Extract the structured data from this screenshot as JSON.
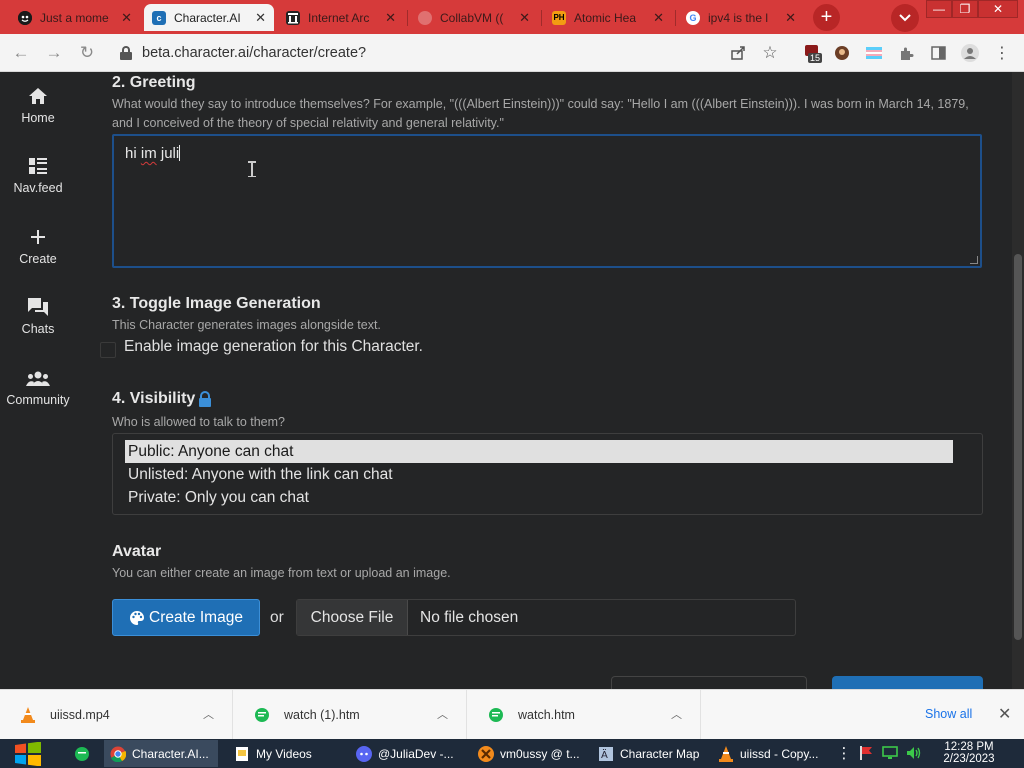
{
  "browser": {
    "tabs": [
      {
        "title": "Just a mome"
      },
      {
        "title": "Character.AI"
      },
      {
        "title": "Internet Arc"
      },
      {
        "title": "CollabVM (("
      },
      {
        "title": "Atomic Hea"
      },
      {
        "title": "ipv4 is the l"
      }
    ],
    "url": "beta.character.ai/character/create?",
    "extension_badge": "15"
  },
  "sidebar": {
    "items": [
      {
        "label": "Home"
      },
      {
        "label": "Nav.feed"
      },
      {
        "label": "Create"
      },
      {
        "label": "Chats"
      },
      {
        "label": "Community"
      }
    ]
  },
  "form": {
    "greeting": {
      "heading": "2. Greeting",
      "hint": "What would they say to introduce themselves? For example, \"(((Albert Einstein)))\" could say: \"Hello I am (((Albert Einstein))). I was born in March 14, 1879, and I conceived of the theory of special relativity and general relativity.\"",
      "value_word1": "hi",
      "value_word2": "im",
      "value_word3": "juli"
    },
    "image_gen": {
      "heading": "3. Toggle Image Generation",
      "hint": "This Character generates images alongside text.",
      "checkbox_label": "Enable image generation for this Character."
    },
    "visibility": {
      "heading": "4. Visibility",
      "hint": "Who is allowed to talk to them?",
      "options": [
        "Public: Anyone can chat",
        "Unlisted: Anyone with the link can chat",
        "Private: Only you can chat"
      ],
      "selected": "Public: Anyone can chat"
    },
    "avatar": {
      "heading": "Avatar",
      "hint": "You can either create an image from text or upload an image.",
      "create_button": "Create Image",
      "or": "or",
      "choose_file": "Choose File",
      "no_file": "No file chosen"
    }
  },
  "downloads": {
    "items": [
      {
        "name": "uiissd.mp4"
      },
      {
        "name": "watch (1).htm"
      },
      {
        "name": "watch.htm"
      }
    ],
    "show_all": "Show all"
  },
  "taskbar": {
    "apps": [
      {
        "label": "Character.AI..."
      },
      {
        "label": "My Videos"
      },
      {
        "label": "@JuliaDev -..."
      },
      {
        "label": "vm0ussy @ t..."
      },
      {
        "label": "Character Map"
      },
      {
        "label": "uiissd - Copy..."
      }
    ],
    "time": "12:28 PM",
    "date": "2/23/2023"
  },
  "colors": {
    "tabbar": "#d63a3a",
    "page_bg": "#242526",
    "accent": "#1f6fb5",
    "lock_icon": "#3b8fd8"
  }
}
